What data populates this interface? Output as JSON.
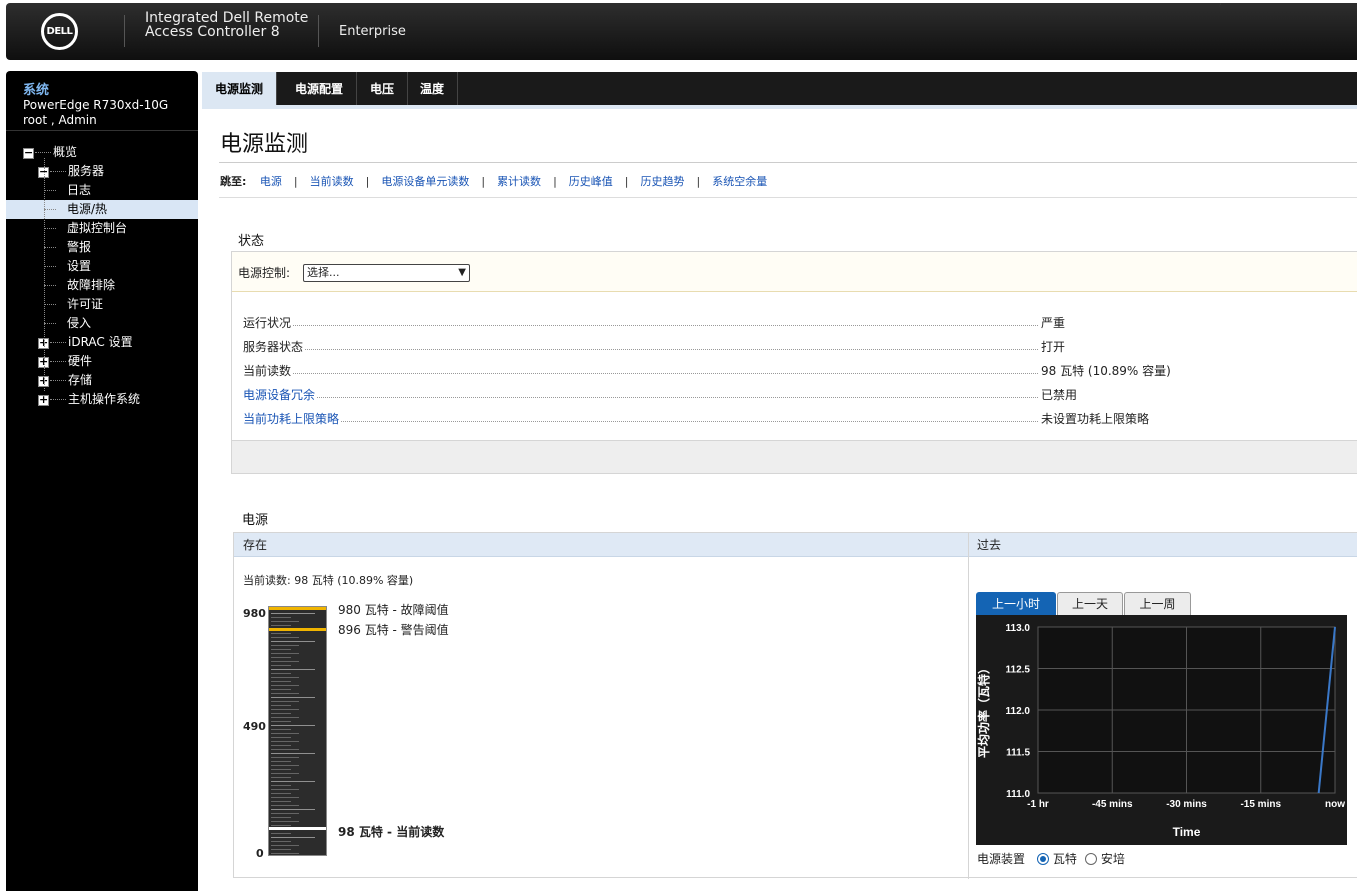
{
  "banner": {
    "logo": "DELL",
    "product_line1": "Integrated Dell Remote",
    "product_line2": "Access Controller 8",
    "edition": "Enterprise"
  },
  "sidebar": {
    "system_label": "系统",
    "host": "PowerEdge R730xd-10G",
    "user": "root , Admin",
    "tree": [
      {
        "label": "概览",
        "expander": "−",
        "level": 0
      },
      {
        "label": "服务器",
        "expander": "−",
        "level": 1
      },
      {
        "label": "日志",
        "level": 2
      },
      {
        "label": "电源/热",
        "level": 2,
        "selected": true
      },
      {
        "label": "虚拟控制台",
        "level": 2
      },
      {
        "label": "警报",
        "level": 2
      },
      {
        "label": "设置",
        "level": 2
      },
      {
        "label": "故障排除",
        "level": 2
      },
      {
        "label": "许可证",
        "level": 2
      },
      {
        "label": "侵入",
        "level": 2
      },
      {
        "label": "iDRAC 设置",
        "expander": "+",
        "level": 1
      },
      {
        "label": "硬件",
        "expander": "+",
        "level": 1
      },
      {
        "label": "存储",
        "expander": "+",
        "level": 1
      },
      {
        "label": "主机操作系统",
        "expander": "+",
        "level": 1
      }
    ]
  },
  "tabs": [
    {
      "label": "电源监测",
      "active": true
    },
    {
      "label": "电源配置"
    },
    {
      "label": "电压"
    },
    {
      "label": "温度"
    }
  ],
  "page_title": "电源监测",
  "jump": {
    "label": "跳至:",
    "links": [
      "电源",
      "当前读数",
      "电源设备单元读数",
      "累计读数",
      "历史峰值",
      "历史趋势",
      "系统空余量"
    ]
  },
  "status": {
    "title": "状态",
    "control_label": "电源控制:",
    "control_value": "选择...",
    "rows": [
      {
        "key": "运行状况",
        "value": "严重",
        "link": false
      },
      {
        "key": "服务器状态",
        "value": "打开",
        "link": false
      },
      {
        "key": "当前读数",
        "value": "98 瓦特 (10.89% 容量)",
        "link": false
      },
      {
        "key": "电源设备冗余",
        "value": "已禁用",
        "link": true
      },
      {
        "key": "当前功耗上限策略",
        "value": "未设置功耗上限策略",
        "link": true
      }
    ]
  },
  "power": {
    "title": "电源",
    "present_header": "存在",
    "past_header": "过去",
    "current": "当前读数: 98 瓦特 (10.89% 容量)",
    "gauge": {
      "max": 980,
      "mid": 490,
      "min": 0,
      "failure": 980,
      "warning": 896,
      "reading": 98,
      "max_label": "980",
      "mid_label": "490",
      "min_label": "0",
      "failure_note": "980 瓦特 - 故障阈值",
      "warning_note": "896 瓦特 - 警告阈值",
      "reading_note": "98 瓦特 - 当前读数",
      "colors": {
        "failure": "#f0b400",
        "warning": "#f0b400",
        "reading": "#ffffff"
      }
    },
    "range_tabs": [
      {
        "label": "上一小时",
        "active": true
      },
      {
        "label": "上一天"
      },
      {
        "label": "上一周"
      }
    ],
    "unit_label": "电源装置",
    "units": [
      {
        "label": "瓦特",
        "selected": true
      },
      {
        "label": "安培",
        "selected": false
      }
    ]
  },
  "chart_data": {
    "type": "line",
    "xlabel": "Time",
    "ylabel": "平均功率（瓦特）",
    "x_ticks": [
      "-1 hr",
      "-45 mins",
      "-30 mins",
      "-15 mins",
      "now"
    ],
    "y_ticks": [
      "113.0",
      "112.5",
      "112.0",
      "111.5",
      "111.0"
    ],
    "ylim": [
      111.0,
      113.0
    ],
    "x_minutes": [
      -3.3,
      0
    ],
    "values": [
      111.0,
      113.0
    ],
    "grid": true,
    "line_color": "#3a78c8"
  }
}
